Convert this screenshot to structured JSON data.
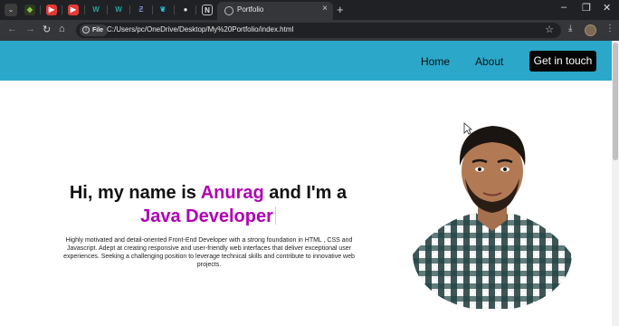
{
  "browser": {
    "tab_title": "Portfolio",
    "pinned_tabs": [
      {
        "icon": "shield-icon",
        "color": "#8bc34a"
      },
      {
        "icon": "youtube-icon",
        "color": "#e53935"
      },
      {
        "icon": "youtube-icon",
        "color": "#e53935"
      },
      {
        "icon": "w-icon",
        "color": "#26a69a"
      },
      {
        "icon": "w-icon",
        "color": "#26a69a"
      },
      {
        "icon": "z-icon",
        "color": "#5c6bc0"
      },
      {
        "icon": "leaf-icon",
        "color": "#26c6da"
      },
      {
        "icon": "github-icon",
        "color": "#e0e0e0"
      },
      {
        "icon": "notion-icon",
        "color": "#e0e0e0"
      }
    ],
    "file_chip": "File",
    "url": "C:/Users/pc/OneDrive/Desktop/My%20Portfolio/index.html"
  },
  "nav": {
    "links": [
      "Home",
      "About"
    ],
    "cta": "Get in touch"
  },
  "hero": {
    "greeting_pre": "Hi, my name is ",
    "name": "Anurag",
    "greeting_post": " and I'm a",
    "role": "Java Developer",
    "bio": "Highly motivated and detail-oriented Front-End Developer with a strong foundation in HTML , CSS and Javascript. Adept at creating responsive and user-friendly web interfaces that deliver exceptional user experiences. Seeking a challenging position to leverage technical skills and contribute to innovative web projects."
  },
  "colors": {
    "navbar": "#2aa7c9",
    "accent": "#b000b5",
    "cta_bg": "#050505"
  }
}
